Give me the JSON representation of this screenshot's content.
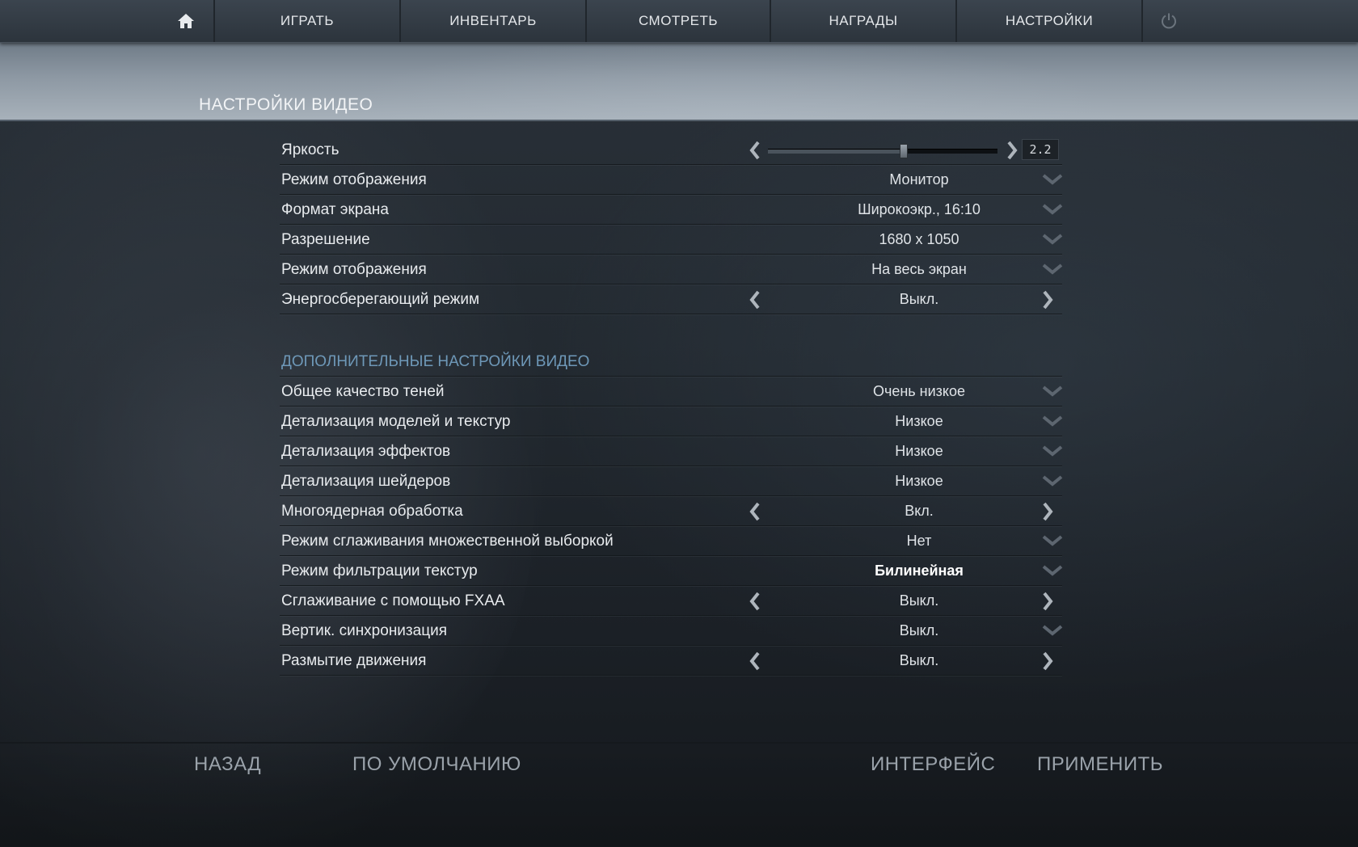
{
  "nav": {
    "items": [
      {
        "label": "ИГРАТЬ"
      },
      {
        "label": "ИНВЕНТАРЬ"
      },
      {
        "label": "СМОТРЕТЬ"
      },
      {
        "label": "НАГРАДЫ"
      },
      {
        "label": "НАСТРОЙКИ"
      }
    ],
    "home_icon": "home-icon",
    "power_icon": "power-icon"
  },
  "page_title": "НАСТРОЙКИ ВИДЕО",
  "basic": [
    {
      "label": "Яркость",
      "type": "slider",
      "value": "2.2",
      "level": 0.59
    },
    {
      "label": "Режим отображения",
      "type": "dropdown",
      "value": "Монитор"
    },
    {
      "label": "Формат экрана",
      "type": "dropdown",
      "value": "Широкоэкр., 16:10"
    },
    {
      "label": "Разрешение",
      "type": "dropdown",
      "value": "1680 x 1050"
    },
    {
      "label": "Режим отображения",
      "type": "dropdown",
      "value": "На весь экран"
    },
    {
      "label": "Энергосберегающий режим",
      "type": "toggle",
      "value": "Выкл."
    }
  ],
  "advanced_title": "ДОПОЛНИТЕЛЬНЫЕ НАСТРОЙКИ ВИДЕО",
  "advanced": [
    {
      "label": "Общее качество теней",
      "type": "dropdown",
      "value": "Очень низкое"
    },
    {
      "label": "Детализация моделей и текстур",
      "type": "dropdown",
      "value": "Низкое"
    },
    {
      "label": "Детализация эффектов",
      "type": "dropdown",
      "value": "Низкое"
    },
    {
      "label": "Детализация шейдеров",
      "type": "dropdown",
      "value": "Низкое"
    },
    {
      "label": "Многоядерная обработка",
      "type": "toggle",
      "value": "Вкл."
    },
    {
      "label": "Режим сглаживания множественной выборкой",
      "type": "dropdown",
      "value": "Нет"
    },
    {
      "label": "Режим фильтрации текстур",
      "type": "dropdown",
      "value": "Билинейная"
    },
    {
      "label": "Сглаживание с помощью FXAA",
      "type": "toggle",
      "value": "Выкл."
    },
    {
      "label": "Вертик. синхронизация",
      "type": "dropdown",
      "value": "Выкл."
    },
    {
      "label": "Размытие движения",
      "type": "toggle",
      "value": "Выкл."
    }
  ],
  "footer": {
    "back": "НАЗАД",
    "defaults": "ПО УМОЛЧАНИЮ",
    "interface": "ИНТЕРФЕЙС",
    "apply": "ПРИМЕНИТЬ"
  },
  "colors": {
    "accent_blue": "#6e98b8",
    "header_band": "#8d98a3",
    "background": "#232a31"
  }
}
